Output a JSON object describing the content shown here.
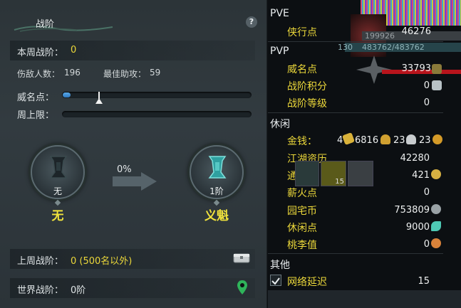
{
  "left": {
    "title": "战阶",
    "help": "?",
    "week_rank_label": "本周战阶：",
    "week_rank_value": "0",
    "kills_label": "伤敌人数：",
    "kills_value": "196",
    "assist_label": "最佳助攻：",
    "assist_value": "59",
    "prestige_label": "威名点：",
    "prestige_progress": 0.04,
    "weekly_cap_label": "周上限：",
    "weekly_cap_progress": 0,
    "current_rank": {
      "level": "无",
      "name": "无"
    },
    "next_rank": {
      "level": "1阶",
      "name": "义魁"
    },
    "rank_progress_pct": "0%",
    "last_week_label": "上周战阶：",
    "last_week_value": "0 (500名以外)",
    "world_rank_label": "世界战阶：",
    "world_rank_value": "0阶"
  },
  "right": {
    "top_overlay": {
      "hp_text": "199926",
      "mp_text": "483762/483762",
      "level": "130"
    },
    "pve": {
      "title": "PVE",
      "rows": [
        {
          "label": "侠行点",
          "value": "46276"
        }
      ]
    },
    "pvp": {
      "title": "PVP",
      "rows": [
        {
          "label": "威名点",
          "value": "33793"
        },
        {
          "label": "战阶积分",
          "value": "0"
        },
        {
          "label": "战阶等级",
          "value": "0"
        }
      ]
    },
    "leisure": {
      "title": "休闲",
      "rows": [
        {
          "label": "金钱：",
          "value": "4",
          "value2": "6816",
          "value3": "23",
          "value4": "23"
        },
        {
          "label": "江湖资历",
          "value": "42280"
        },
        {
          "label": "通宝",
          "value": "421"
        },
        {
          "label": "薪火点",
          "value": "0"
        },
        {
          "label": "园宅币",
          "value": "753809"
        },
        {
          "label": "休闲点",
          "value": "9000"
        },
        {
          "label": "桃李值",
          "value": "0"
        }
      ]
    },
    "other": {
      "title": "其他",
      "rows": [
        {
          "label": "网络延迟",
          "value": "15",
          "checked": true
        }
      ]
    },
    "item_slot_count": "15",
    "colors": {
      "gold": "#ecd83a",
      "accent_blue": "#3d8fd8"
    }
  }
}
